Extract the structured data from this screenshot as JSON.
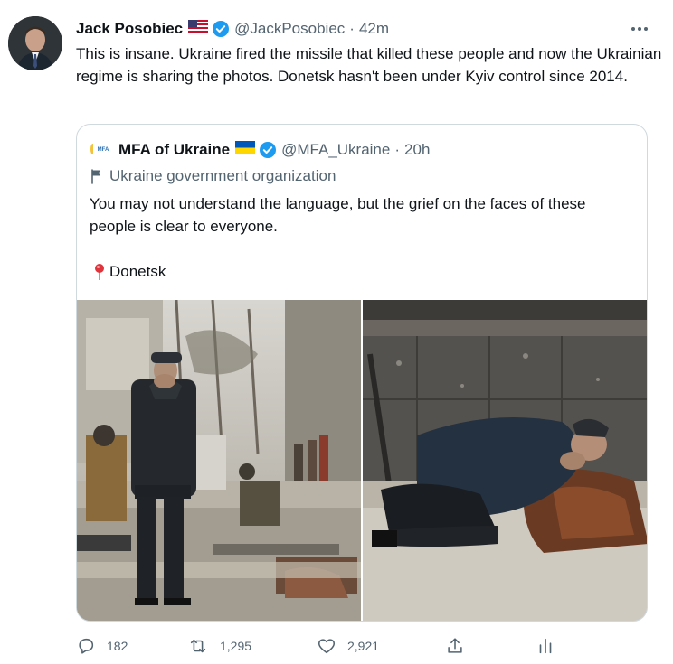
{
  "author": {
    "name": "Jack Posobiec",
    "flag": "us-flag",
    "verified": true,
    "handle": "@JackPosobiec",
    "separator": "·",
    "time": "42m"
  },
  "tweet_text": "This is insane. Ukraine fired the missile that killed these people and now the Ukrainian regime is sharing the photos. Donetsk hasn't been under Kyiv control since 2014.",
  "more_icon": "more-horizontal-icon",
  "quoted": {
    "avatar_text": "MFA",
    "name": "MFA of Ukraine",
    "flag": "ukraine-flag",
    "verified": true,
    "handle": "@MFA_Ukraine",
    "separator": "·",
    "time": "20h",
    "label": "Ukraine government organization",
    "text": "You may not understand the language, but the grief on the faces of these people is clear to everyone.",
    "location": "Donetsk"
  },
  "actions": {
    "replies": "182",
    "retweets": "1,295",
    "likes": "2,921"
  },
  "colors": {
    "text": "#0f1419",
    "secondary": "#536471",
    "verified": "#1d9bf0",
    "border": "#cfd9de"
  }
}
